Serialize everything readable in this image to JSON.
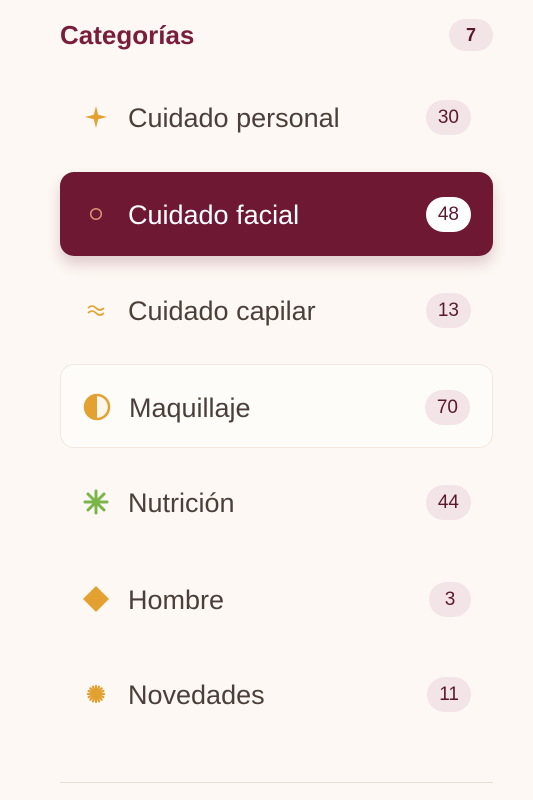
{
  "colors": {
    "accent": "#7a1c3c",
    "active_bg": "#6e1834",
    "badge_bg": "#f3e4e8",
    "gold": "#e3a132",
    "green": "#79b548",
    "background": "#fdf8f3"
  },
  "categories": {
    "title": "Categorías",
    "count": "7",
    "items": [
      {
        "label": "Cuidado personal",
        "count": "30",
        "icon": "sparkle-icon",
        "state": "normal"
      },
      {
        "label": "Cuidado facial",
        "count": "48",
        "icon": "circle-outline-icon",
        "state": "active"
      },
      {
        "label": "Cuidado capilar",
        "count": "13",
        "icon": "wave-icon",
        "state": "normal"
      },
      {
        "label": "Maquillaje",
        "count": "70",
        "icon": "half-circle-icon",
        "state": "hovered"
      },
      {
        "label": "Nutrición",
        "count": "44",
        "icon": "asterisk-icon",
        "state": "normal"
      },
      {
        "label": "Hombre",
        "count": "3",
        "icon": "diamond-icon",
        "state": "normal"
      },
      {
        "label": "Novedades",
        "count": "11",
        "icon": "starburst-icon",
        "state": "normal"
      }
    ]
  }
}
